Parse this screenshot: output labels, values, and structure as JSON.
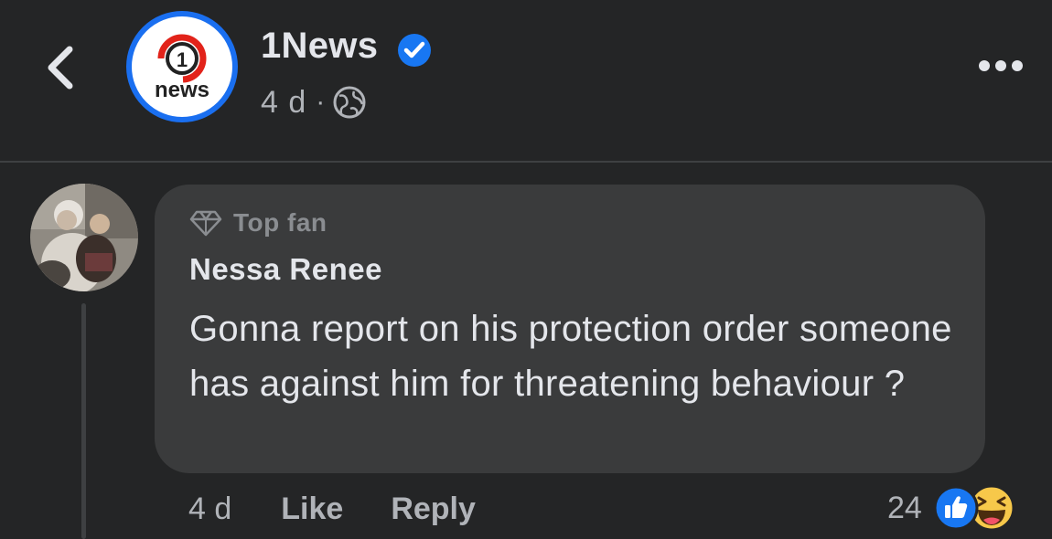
{
  "header": {
    "page_name": "1News",
    "post_time": "4 d",
    "meta_separator": "·",
    "logo": {
      "number": "1",
      "word": "news",
      "ring_color": "#1a6ff0",
      "accent_color": "#e2231a"
    },
    "icons": [
      "back-icon",
      "verified-icon",
      "globe-icon",
      "more-icon"
    ]
  },
  "comment": {
    "badge": "Top fan",
    "author": "Nessa Renee",
    "text": "Gonna report on his protection order someone has against him for threatening behaviour ?",
    "time": "4 d",
    "like_label": "Like",
    "reply_label": "Reply",
    "reaction_count": "24",
    "reactions": [
      "like-reaction-icon",
      "haha-reaction-icon"
    ]
  },
  "colors": {
    "background": "#242526",
    "bubble": "#3a3b3c",
    "primary_text": "#e4e6eb",
    "secondary_text": "#b0b3b8",
    "verified_blue": "#1877f2"
  }
}
